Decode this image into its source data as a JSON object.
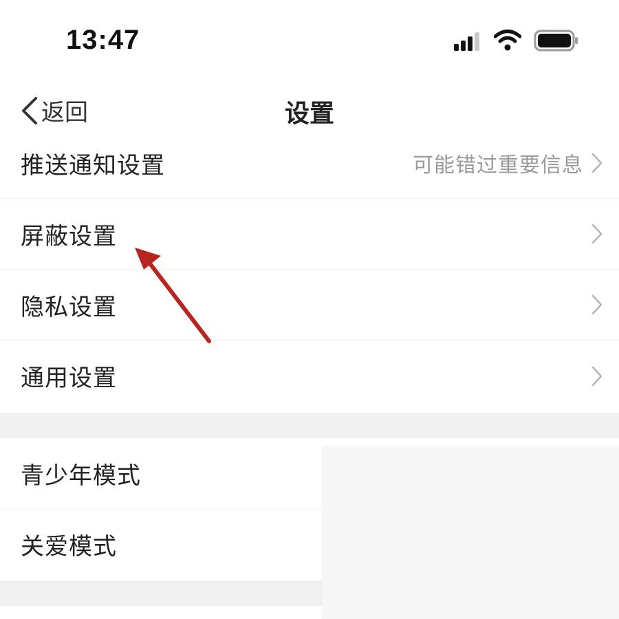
{
  "status_bar": {
    "time": "13:47"
  },
  "nav": {
    "back_label": "返回",
    "title": "设置"
  },
  "section1": [
    {
      "label": "推送通知设置",
      "subtitle": "可能错过重要信息"
    },
    {
      "label": "屏蔽设置"
    },
    {
      "label": "隐私设置"
    },
    {
      "label": "通用设置"
    }
  ],
  "section2": [
    {
      "label": "青少年模式"
    },
    {
      "label": "关爱模式"
    }
  ],
  "icons": {
    "chevron": "chevron-right-icon",
    "back": "chevron-left-icon",
    "annotation": "red-arrow-icon"
  },
  "colors": {
    "annotation_arrow": "#b8241f",
    "separator": "#f0f0f0",
    "subtitle": "#9a9a9a"
  }
}
